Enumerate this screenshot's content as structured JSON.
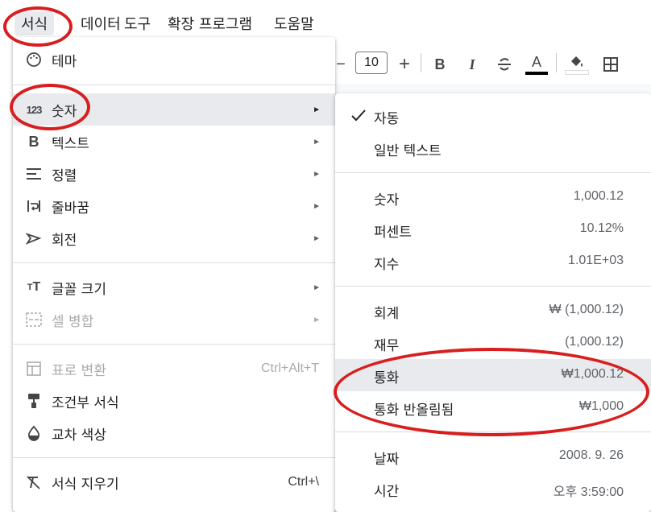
{
  "menubar": {
    "items": [
      {
        "label": "서식"
      },
      {
        "label": "데이터"
      },
      {
        "label": "도구"
      },
      {
        "label": "확장 프로그램"
      },
      {
        "label": "도움말"
      }
    ]
  },
  "toolbar": {
    "minus": "−",
    "font_size": "10",
    "plus": "+",
    "bold": "B",
    "italic": "I",
    "text_color": "A"
  },
  "format_menu": {
    "items": [
      {
        "label": "테마",
        "icon": "palette-icon"
      },
      {
        "label": "숫자",
        "icon": "number-123-icon",
        "submenu": true
      },
      {
        "label": "텍스트",
        "icon": "bold-icon",
        "submenu": true
      },
      {
        "label": "정렬",
        "icon": "align-icon",
        "submenu": true
      },
      {
        "label": "줄바꿈",
        "icon": "wrap-icon",
        "submenu": true
      },
      {
        "label": "회전",
        "icon": "rotate-icon",
        "submenu": true
      },
      {
        "label": "글꼴 크기",
        "icon": "font-size-icon",
        "submenu": true
      },
      {
        "label": "셀 병합",
        "icon": "merge-icon",
        "submenu": true,
        "disabled": true
      },
      {
        "label": "표로 변환",
        "icon": "table-icon",
        "shortcut": "Ctrl+Alt+T",
        "disabled": true
      },
      {
        "label": "조건부 서식",
        "icon": "paint-roller-icon"
      },
      {
        "label": "교차 색상",
        "icon": "drop-icon"
      },
      {
        "label": "서식 지우기",
        "icon": "clear-format-icon",
        "shortcut": "Ctrl+\\"
      }
    ]
  },
  "number_submenu": {
    "items": [
      {
        "label": "자동",
        "checked": true
      },
      {
        "label": "일반 텍스트"
      },
      {
        "label": "숫자",
        "value": "1,000.12"
      },
      {
        "label": "퍼센트",
        "value": "10.12%"
      },
      {
        "label": "지수",
        "value": "1.01E+03"
      },
      {
        "label": "회계",
        "value": "₩ (1,000.12)"
      },
      {
        "label": "재무",
        "value": "(1,000.12)"
      },
      {
        "label": "통화",
        "value": "₩1,000.12"
      },
      {
        "label": "통화 반올림됨",
        "value": "₩1,000"
      },
      {
        "label": "날짜",
        "value": "2008. 9. 26"
      },
      {
        "label": "시간",
        "value": "오후 3:59:00"
      }
    ]
  },
  "colors": {
    "annotation": "#d81e1e",
    "hover": "#e8eaed"
  }
}
